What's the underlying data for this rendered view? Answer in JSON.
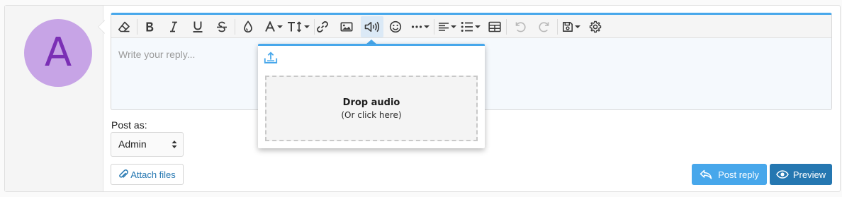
{
  "avatar": {
    "letter": "A",
    "bg": "#c7a4e6",
    "fg": "#7b2fb5"
  },
  "editor": {
    "placeholder": "Write your reply...",
    "toolbar": [
      {
        "name": "remove-format",
        "icon": "eraser-icon"
      },
      {
        "name": "bold",
        "icon": "bold-icon"
      },
      {
        "name": "italic",
        "icon": "italic-icon"
      },
      {
        "name": "underline",
        "icon": "underline-icon"
      },
      {
        "name": "strikethrough",
        "icon": "strikethrough-icon"
      },
      {
        "name": "text-color",
        "icon": "droplet-icon"
      },
      {
        "name": "font-family",
        "icon": "font-icon"
      },
      {
        "name": "font-size",
        "icon": "text-height-icon"
      },
      {
        "name": "link",
        "icon": "link-icon"
      },
      {
        "name": "image",
        "icon": "image-icon"
      },
      {
        "name": "audio",
        "icon": "volume-icon",
        "active": true
      },
      {
        "name": "emoji",
        "icon": "smile-icon"
      },
      {
        "name": "more-options",
        "icon": "ellipsis-icon"
      },
      {
        "name": "align",
        "icon": "align-left-icon"
      },
      {
        "name": "list",
        "icon": "list-icon"
      },
      {
        "name": "table",
        "icon": "table-icon"
      },
      {
        "name": "undo",
        "icon": "undo-icon",
        "disabled": true
      },
      {
        "name": "redo",
        "icon": "redo-icon",
        "disabled": true
      },
      {
        "name": "drafts",
        "icon": "save-icon"
      },
      {
        "name": "settings",
        "icon": "gear-icon"
      }
    ]
  },
  "audio_popup": {
    "drop_title": "Drop audio",
    "drop_subtitle": "(Or click here)"
  },
  "post_as": {
    "label": "Post as:",
    "selected": "Admin"
  },
  "buttons": {
    "attach": "Attach files",
    "post_reply": "Post reply",
    "preview": "Preview"
  },
  "colors": {
    "accent": "#47a7eb",
    "primary_button": "#2577b1",
    "active_toolbar": "#dbe9f6"
  }
}
